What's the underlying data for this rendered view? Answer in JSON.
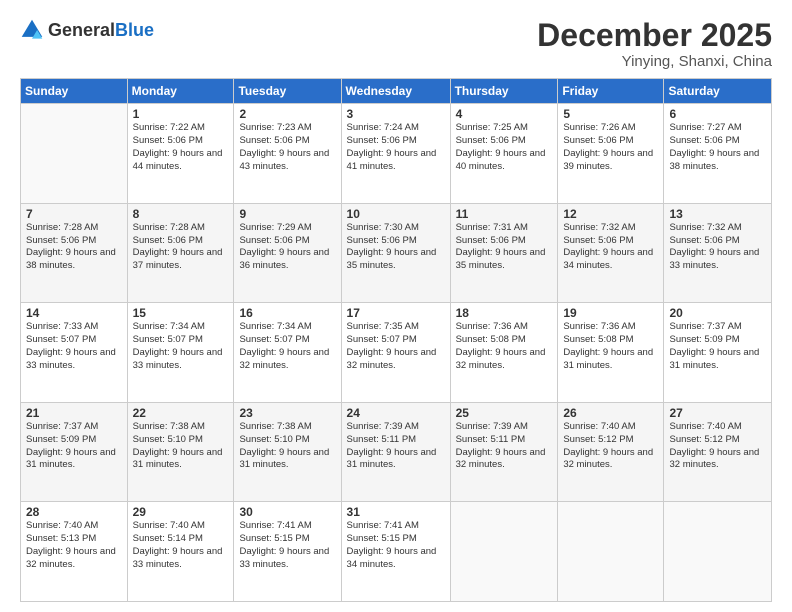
{
  "header": {
    "logo": {
      "general": "General",
      "blue": "Blue"
    },
    "month": "December 2025",
    "location": "Yinying, Shanxi, China"
  },
  "weekdays": [
    "Sunday",
    "Monday",
    "Tuesday",
    "Wednesday",
    "Thursday",
    "Friday",
    "Saturday"
  ],
  "weeks": [
    [
      {
        "day": "",
        "sunrise": "",
        "sunset": "",
        "daylight": ""
      },
      {
        "day": "1",
        "sunrise": "Sunrise: 7:22 AM",
        "sunset": "Sunset: 5:06 PM",
        "daylight": "Daylight: 9 hours and 44 minutes."
      },
      {
        "day": "2",
        "sunrise": "Sunrise: 7:23 AM",
        "sunset": "Sunset: 5:06 PM",
        "daylight": "Daylight: 9 hours and 43 minutes."
      },
      {
        "day": "3",
        "sunrise": "Sunrise: 7:24 AM",
        "sunset": "Sunset: 5:06 PM",
        "daylight": "Daylight: 9 hours and 41 minutes."
      },
      {
        "day": "4",
        "sunrise": "Sunrise: 7:25 AM",
        "sunset": "Sunset: 5:06 PM",
        "daylight": "Daylight: 9 hours and 40 minutes."
      },
      {
        "day": "5",
        "sunrise": "Sunrise: 7:26 AM",
        "sunset": "Sunset: 5:06 PM",
        "daylight": "Daylight: 9 hours and 39 minutes."
      },
      {
        "day": "6",
        "sunrise": "Sunrise: 7:27 AM",
        "sunset": "Sunset: 5:06 PM",
        "daylight": "Daylight: 9 hours and 38 minutes."
      }
    ],
    [
      {
        "day": "7",
        "sunrise": "Sunrise: 7:28 AM",
        "sunset": "Sunset: 5:06 PM",
        "daylight": "Daylight: 9 hours and 38 minutes."
      },
      {
        "day": "8",
        "sunrise": "Sunrise: 7:28 AM",
        "sunset": "Sunset: 5:06 PM",
        "daylight": "Daylight: 9 hours and 37 minutes."
      },
      {
        "day": "9",
        "sunrise": "Sunrise: 7:29 AM",
        "sunset": "Sunset: 5:06 PM",
        "daylight": "Daylight: 9 hours and 36 minutes."
      },
      {
        "day": "10",
        "sunrise": "Sunrise: 7:30 AM",
        "sunset": "Sunset: 5:06 PM",
        "daylight": "Daylight: 9 hours and 35 minutes."
      },
      {
        "day": "11",
        "sunrise": "Sunrise: 7:31 AM",
        "sunset": "Sunset: 5:06 PM",
        "daylight": "Daylight: 9 hours and 35 minutes."
      },
      {
        "day": "12",
        "sunrise": "Sunrise: 7:32 AM",
        "sunset": "Sunset: 5:06 PM",
        "daylight": "Daylight: 9 hours and 34 minutes."
      },
      {
        "day": "13",
        "sunrise": "Sunrise: 7:32 AM",
        "sunset": "Sunset: 5:06 PM",
        "daylight": "Daylight: 9 hours and 33 minutes."
      }
    ],
    [
      {
        "day": "14",
        "sunrise": "Sunrise: 7:33 AM",
        "sunset": "Sunset: 5:07 PM",
        "daylight": "Daylight: 9 hours and 33 minutes."
      },
      {
        "day": "15",
        "sunrise": "Sunrise: 7:34 AM",
        "sunset": "Sunset: 5:07 PM",
        "daylight": "Daylight: 9 hours and 33 minutes."
      },
      {
        "day": "16",
        "sunrise": "Sunrise: 7:34 AM",
        "sunset": "Sunset: 5:07 PM",
        "daylight": "Daylight: 9 hours and 32 minutes."
      },
      {
        "day": "17",
        "sunrise": "Sunrise: 7:35 AM",
        "sunset": "Sunset: 5:07 PM",
        "daylight": "Daylight: 9 hours and 32 minutes."
      },
      {
        "day": "18",
        "sunrise": "Sunrise: 7:36 AM",
        "sunset": "Sunset: 5:08 PM",
        "daylight": "Daylight: 9 hours and 32 minutes."
      },
      {
        "day": "19",
        "sunrise": "Sunrise: 7:36 AM",
        "sunset": "Sunset: 5:08 PM",
        "daylight": "Daylight: 9 hours and 31 minutes."
      },
      {
        "day": "20",
        "sunrise": "Sunrise: 7:37 AM",
        "sunset": "Sunset: 5:09 PM",
        "daylight": "Daylight: 9 hours and 31 minutes."
      }
    ],
    [
      {
        "day": "21",
        "sunrise": "Sunrise: 7:37 AM",
        "sunset": "Sunset: 5:09 PM",
        "daylight": "Daylight: 9 hours and 31 minutes."
      },
      {
        "day": "22",
        "sunrise": "Sunrise: 7:38 AM",
        "sunset": "Sunset: 5:10 PM",
        "daylight": "Daylight: 9 hours and 31 minutes."
      },
      {
        "day": "23",
        "sunrise": "Sunrise: 7:38 AM",
        "sunset": "Sunset: 5:10 PM",
        "daylight": "Daylight: 9 hours and 31 minutes."
      },
      {
        "day": "24",
        "sunrise": "Sunrise: 7:39 AM",
        "sunset": "Sunset: 5:11 PM",
        "daylight": "Daylight: 9 hours and 31 minutes."
      },
      {
        "day": "25",
        "sunrise": "Sunrise: 7:39 AM",
        "sunset": "Sunset: 5:11 PM",
        "daylight": "Daylight: 9 hours and 32 minutes."
      },
      {
        "day": "26",
        "sunrise": "Sunrise: 7:40 AM",
        "sunset": "Sunset: 5:12 PM",
        "daylight": "Daylight: 9 hours and 32 minutes."
      },
      {
        "day": "27",
        "sunrise": "Sunrise: 7:40 AM",
        "sunset": "Sunset: 5:12 PM",
        "daylight": "Daylight: 9 hours and 32 minutes."
      }
    ],
    [
      {
        "day": "28",
        "sunrise": "Sunrise: 7:40 AM",
        "sunset": "Sunset: 5:13 PM",
        "daylight": "Daylight: 9 hours and 32 minutes."
      },
      {
        "day": "29",
        "sunrise": "Sunrise: 7:40 AM",
        "sunset": "Sunset: 5:14 PM",
        "daylight": "Daylight: 9 hours and 33 minutes."
      },
      {
        "day": "30",
        "sunrise": "Sunrise: 7:41 AM",
        "sunset": "Sunset: 5:15 PM",
        "daylight": "Daylight: 9 hours and 33 minutes."
      },
      {
        "day": "31",
        "sunrise": "Sunrise: 7:41 AM",
        "sunset": "Sunset: 5:15 PM",
        "daylight": "Daylight: 9 hours and 34 minutes."
      },
      {
        "day": "",
        "sunrise": "",
        "sunset": "",
        "daylight": ""
      },
      {
        "day": "",
        "sunrise": "",
        "sunset": "",
        "daylight": ""
      },
      {
        "day": "",
        "sunrise": "",
        "sunset": "",
        "daylight": ""
      }
    ]
  ]
}
